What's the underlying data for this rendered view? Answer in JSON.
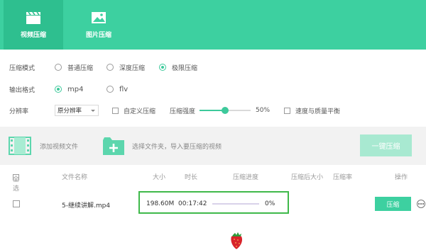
{
  "tabs": [
    {
      "label": "视频压缩",
      "icon": "clapperboard-icon",
      "active": true
    },
    {
      "label": "图片压缩",
      "icon": "image-icon",
      "active": false
    }
  ],
  "settings": {
    "mode": {
      "label": "压缩模式",
      "options": [
        "普通压缩",
        "深度压缩",
        "极限压缩"
      ],
      "selected": "极限压缩"
    },
    "format": {
      "label": "输出格式",
      "options": [
        "mp4",
        "flv"
      ],
      "selected": "mp4"
    },
    "resolution": {
      "label": "分辨率",
      "select_value": "原分辨率",
      "custom_label": "自定义压缩",
      "strength_label": "压缩强度",
      "strength_value": "50%",
      "strength_fraction": 0.5,
      "balance_label": "速度与质量平衡"
    }
  },
  "toolbar": {
    "add_file": "添加视频文件",
    "add_folder": "选择文件夹，导入要压缩的视频",
    "onekey": "一键压缩"
  },
  "table": {
    "headers": {
      "select_all": "全选",
      "name": "文件名称",
      "size": "大小",
      "duration": "时长",
      "progress": "压缩进度",
      "after_size": "压缩后大小",
      "ratio": "压缩率",
      "action": "操作"
    },
    "rows": [
      {
        "name": "5-继续讲解.mp4",
        "size": "198.60M",
        "duration": "00:17:42",
        "progress": "0%",
        "progress_fraction": 0,
        "action": "压缩"
      }
    ]
  },
  "colors": {
    "brand": "#3dd0a0",
    "brand_dark": "#2ebf8f",
    "highlight": "#3fb94a"
  }
}
